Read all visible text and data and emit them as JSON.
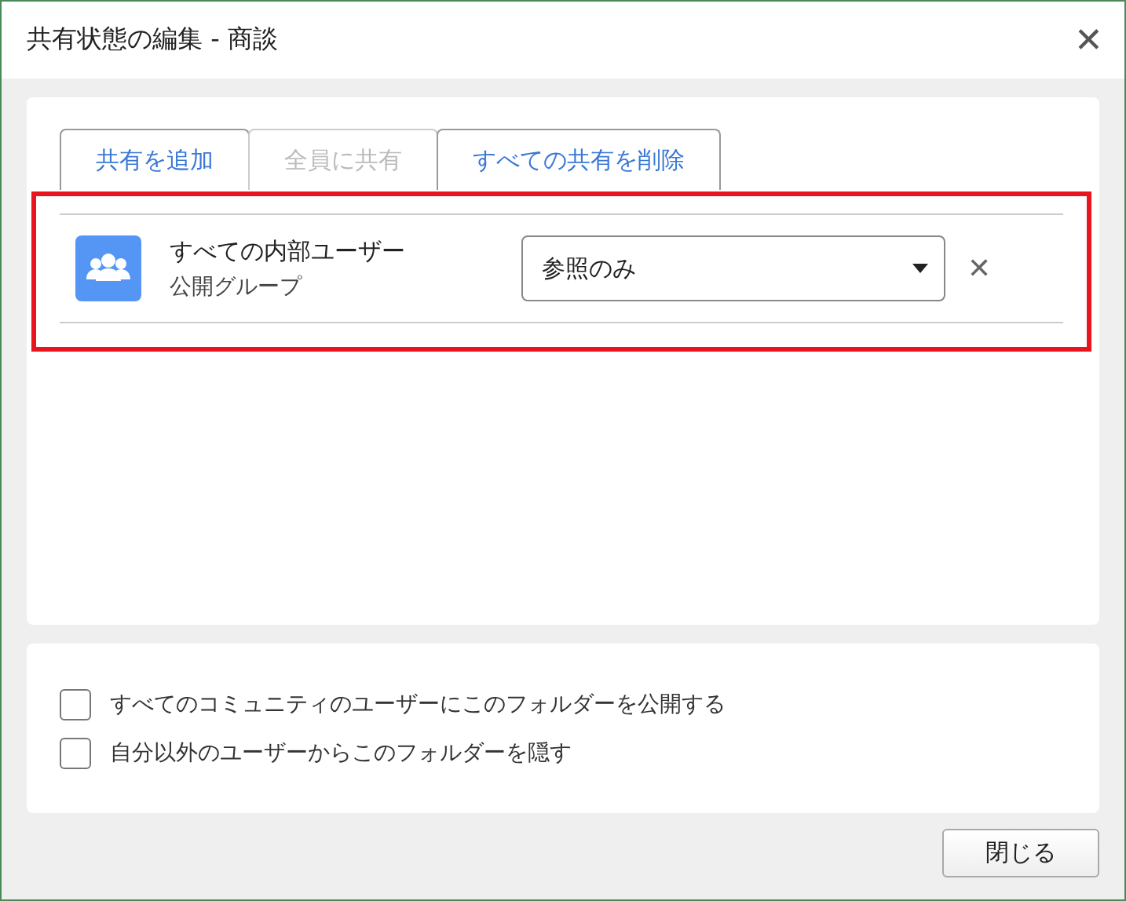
{
  "window": {
    "title": "共有状態の編集 - 商談",
    "close": "✕"
  },
  "tabs": [
    {
      "label": "共有を追加",
      "disabled": false
    },
    {
      "label": "全員に共有",
      "disabled": true
    },
    {
      "label": "すべての共有を削除",
      "disabled": false
    }
  ],
  "shares": [
    {
      "name": "すべての内部ユーザー",
      "type": "公開グループ",
      "access": "参照のみ",
      "remove": "✕"
    }
  ],
  "options": [
    {
      "label": "すべてのコミュニティのユーザーにこのフォルダーを公開する",
      "checked": false
    },
    {
      "label": "自分以外のユーザーからこのフォルダーを隠す",
      "checked": false
    }
  ],
  "buttons": [
    "閉じる"
  ]
}
